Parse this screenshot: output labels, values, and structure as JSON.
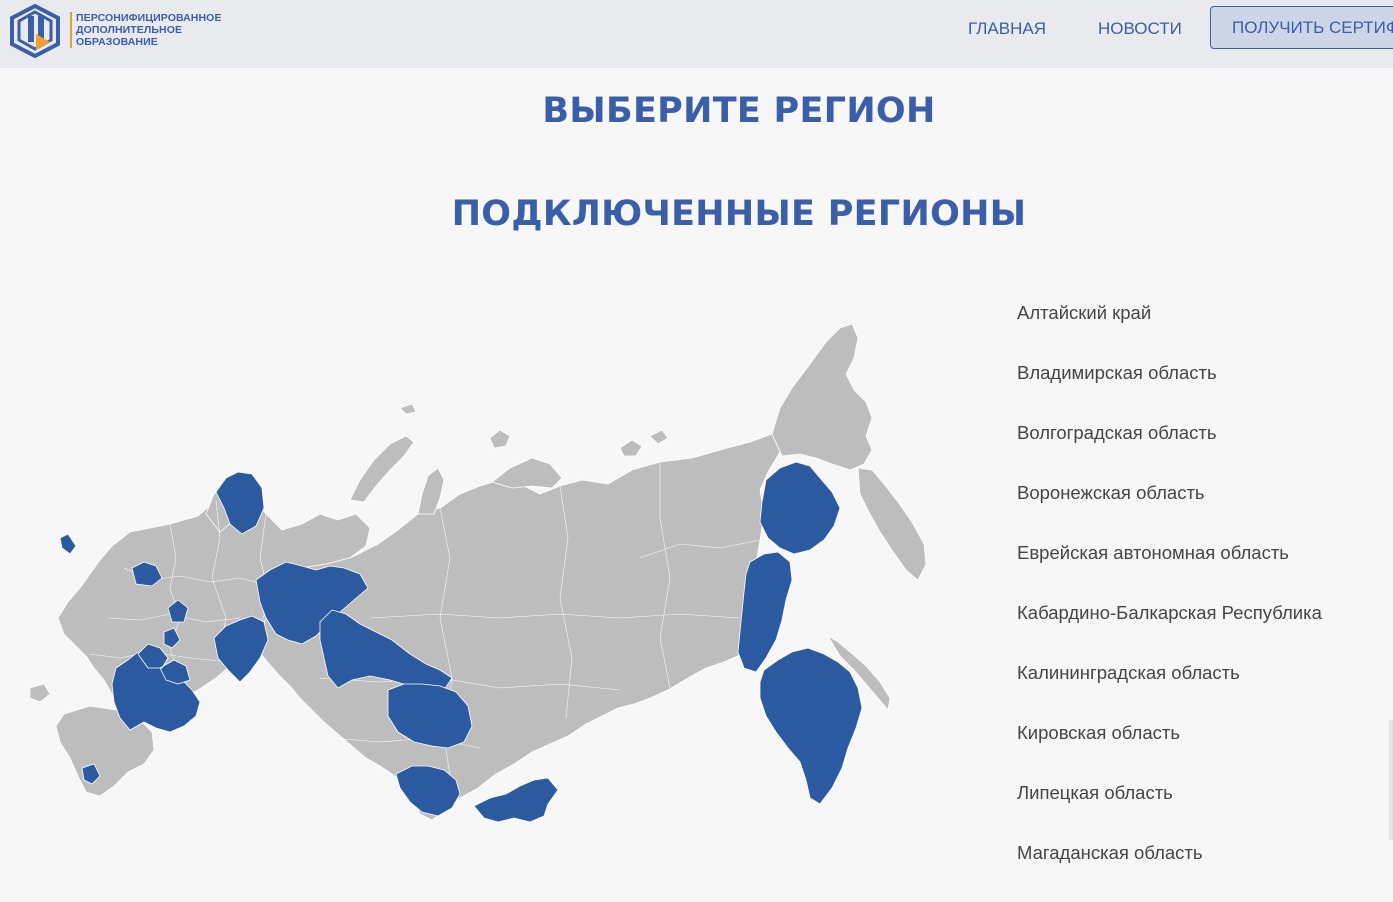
{
  "header": {
    "logo_lines": [
      "ПЕРСОНИФИЦИРОВАННОЕ",
      "ДОПОЛНИТЕЛЬНОЕ",
      "ОБРАЗОВАНИЕ"
    ],
    "nav": [
      "ГЛАВНАЯ",
      "НОВОСТИ"
    ],
    "cert_button_label": "ПОЛУЧИТЬ СЕРТИФИКАТ"
  },
  "main": {
    "title": "ВЫБЕРИТЕ РЕГИОН",
    "subtitle": "ПОДКЛЮЧЕННЫЕ РЕГИОНЫ",
    "regions": [
      "Алтайский край",
      "Владимирская область",
      "Волгоградская область",
      "Воронежская область",
      "Еврейская автономная область",
      "Кабардино-Балкарская Республика",
      "Калининградская область",
      "Кировская область",
      "Липецкая область",
      "Магаданская область"
    ]
  },
  "colors": {
    "brand": "#3a5ea8",
    "region_connected": "#2c5aa0",
    "region_default": "#bdbdbd",
    "logo_accent": "#f0a030"
  },
  "icons": {
    "logo": "pdo-logo-icon"
  }
}
